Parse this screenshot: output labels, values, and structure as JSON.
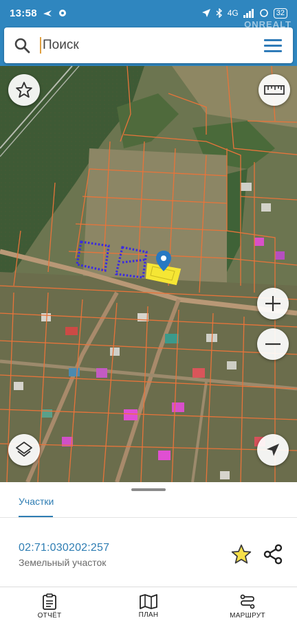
{
  "status_bar": {
    "time": "13:58",
    "network": "4G",
    "battery": "32"
  },
  "watermark": "ONREALT",
  "search": {
    "placeholder": "Поиск"
  },
  "map": {
    "icons": [
      "star-outline-icon",
      "ruler-icon",
      "zoom-in-icon",
      "zoom-out-icon",
      "layers-icon",
      "navigation-arrow-icon",
      "location-pin-icon"
    ]
  },
  "bottom_sheet": {
    "tab_label": "Участки",
    "parcel": {
      "cadastral_number": "02:71:030202:257",
      "type": "Земельный участок"
    }
  },
  "bottom_nav": {
    "items": [
      {
        "label": "ОТЧЁТ",
        "icon": "report-icon"
      },
      {
        "label": "ПЛАН",
        "icon": "map-plan-icon"
      },
      {
        "label": "МАРШРУТ",
        "icon": "route-icon"
      }
    ]
  },
  "colors": {
    "primary": "#2f86bf",
    "accent_text": "#2e7db3",
    "parcel_boundary": "#e8743a",
    "selected_parcel": "#f5e634",
    "favorite_star": "#f2c200"
  }
}
